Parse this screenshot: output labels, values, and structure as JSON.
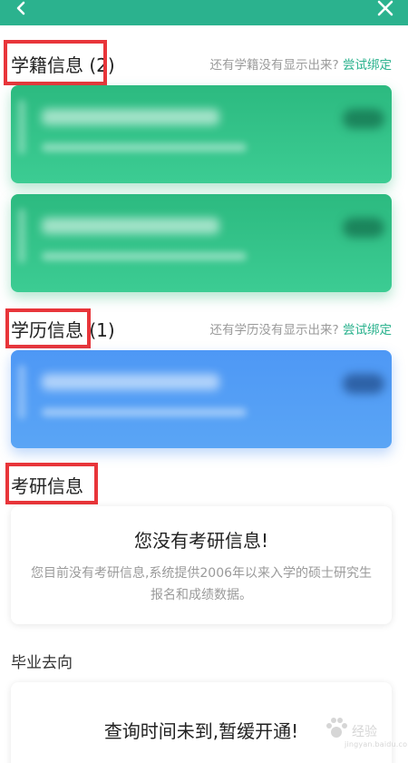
{
  "header": {
    "back_icon": "chevron-left-icon",
    "close_icon": "close-icon",
    "bar_color": "#2bb28e"
  },
  "student_status": {
    "title": "学籍信息",
    "count": "(2)",
    "hint": "还有学籍没有显示出来?",
    "link": "尝试绑定",
    "cards": [
      "green",
      "green"
    ]
  },
  "education": {
    "title": "学历信息",
    "count": "(1)",
    "hint": "还有学历没有显示出来?",
    "link": "尝试绑定",
    "cards": [
      "blue"
    ]
  },
  "postgrad_exam": {
    "title": "考研信息",
    "empty_title": "您没有考研信息!",
    "empty_desc": "您目前没有考研信息,系统提供2006年以来入学的硕士研究生报名和成绩数据。"
  },
  "graduation": {
    "title": "毕业去向",
    "message": "查询时间未到,暂缓开通!"
  },
  "watermark": {
    "text": "经验",
    "url": "jingyan.baidu.com"
  },
  "colors": {
    "accent": "#2bb28e",
    "highlight_box": "#e8353a",
    "card_green": "#2cba80",
    "card_blue": "#4e98f5"
  }
}
